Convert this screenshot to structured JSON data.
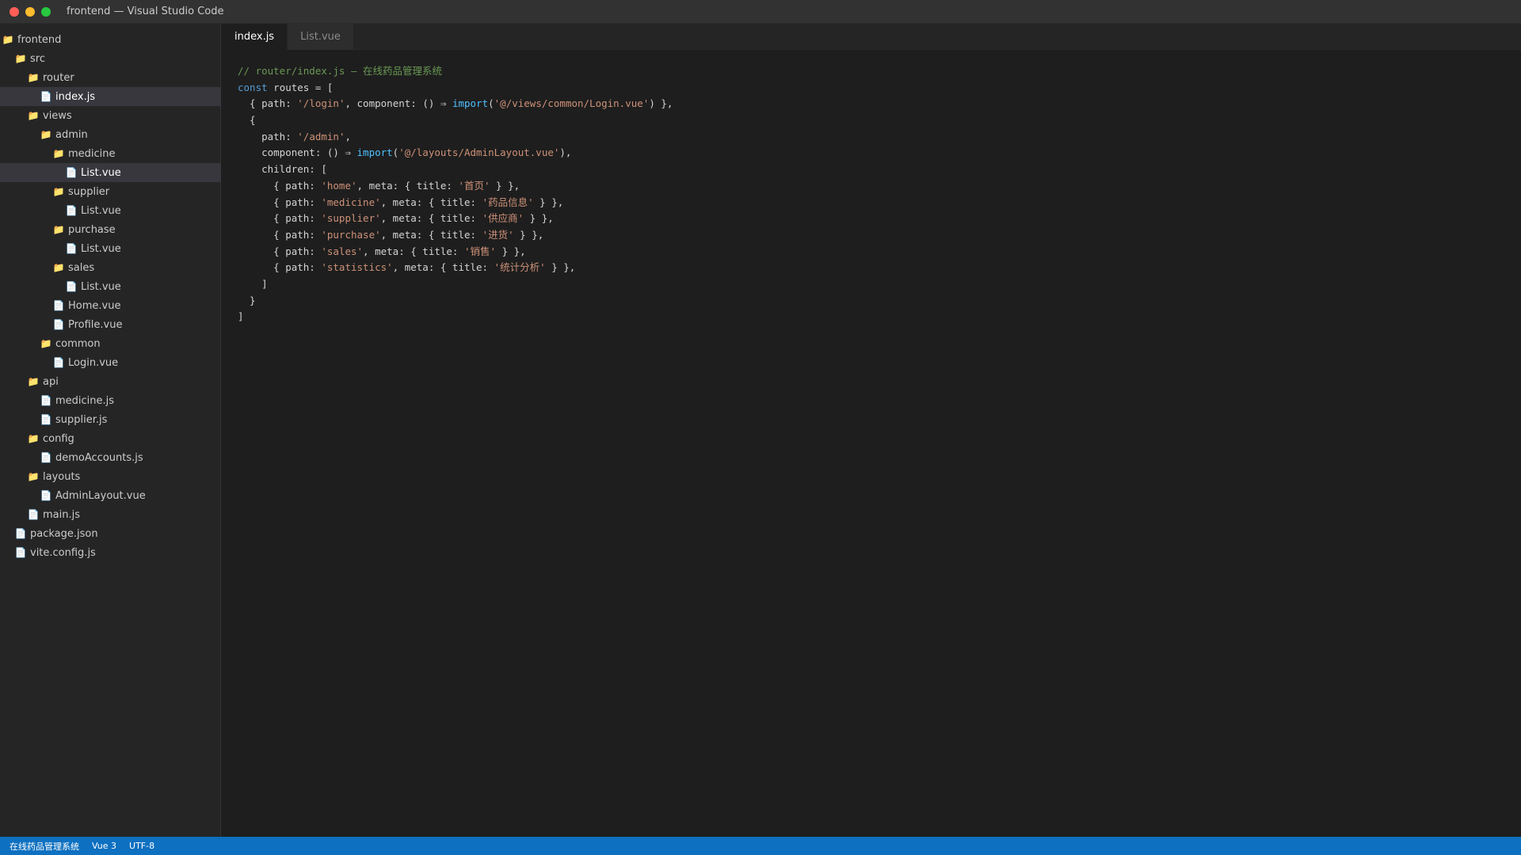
{
  "window": {
    "title": "frontend — Visual Studio Code"
  },
  "explorer": {
    "items": [
      {
        "label": "frontend",
        "type": "folder",
        "depth": 0
      },
      {
        "label": "src",
        "type": "folder",
        "depth": 1
      },
      {
        "label": "router",
        "type": "folder",
        "depth": 2
      },
      {
        "label": "index.js",
        "type": "file",
        "depth": 3,
        "active": true
      },
      {
        "label": "views",
        "type": "folder",
        "depth": 2
      },
      {
        "label": "admin",
        "type": "folder",
        "depth": 3
      },
      {
        "label": "medicine",
        "type": "folder",
        "depth": 4
      },
      {
        "label": "List.vue",
        "type": "file",
        "depth": 5,
        "active": true
      },
      {
        "label": "supplier",
        "type": "folder",
        "depth": 4
      },
      {
        "label": "List.vue",
        "type": "file",
        "depth": 5
      },
      {
        "label": "purchase",
        "type": "folder",
        "depth": 4
      },
      {
        "label": "List.vue",
        "type": "file",
        "depth": 5
      },
      {
        "label": "sales",
        "type": "folder",
        "depth": 4
      },
      {
        "label": "List.vue",
        "type": "file",
        "depth": 5
      },
      {
        "label": "Home.vue",
        "type": "file",
        "depth": 4
      },
      {
        "label": "Profile.vue",
        "type": "file",
        "depth": 4
      },
      {
        "label": "common",
        "type": "folder",
        "depth": 3
      },
      {
        "label": "Login.vue",
        "type": "file",
        "depth": 4
      },
      {
        "label": "api",
        "type": "folder",
        "depth": 2
      },
      {
        "label": "medicine.js",
        "type": "file",
        "depth": 3
      },
      {
        "label": "supplier.js",
        "type": "file",
        "depth": 3
      },
      {
        "label": "config",
        "type": "folder",
        "depth": 2
      },
      {
        "label": "demoAccounts.js",
        "type": "file",
        "depth": 3
      },
      {
        "label": "layouts",
        "type": "folder",
        "depth": 2
      },
      {
        "label": "AdminLayout.vue",
        "type": "file",
        "depth": 3
      },
      {
        "label": "main.js",
        "type": "file",
        "depth": 2
      },
      {
        "label": "package.json",
        "type": "file",
        "depth": 1
      },
      {
        "label": "vite.config.js",
        "type": "file",
        "depth": 1
      }
    ]
  },
  "tabs": [
    {
      "label": "index.js",
      "active": true
    },
    {
      "label": "List.vue",
      "active": false
    }
  ],
  "editor": {
    "lines": [
      [
        {
          "t": "// router/index.js — 在线药品管理系统",
          "c": "cm"
        }
      ],
      [
        {
          "t": "const",
          "c": "kw"
        },
        {
          "t": " routes = ["
        }
      ],
      [
        {
          "t": "  { path: "
        },
        {
          "t": "'/login'",
          "c": "str"
        },
        {
          "t": ", component: () ⇒ "
        },
        {
          "t": "import",
          "c": "fn"
        },
        {
          "t": "("
        },
        {
          "t": "'@/views/common/Login.vue'",
          "c": "str"
        },
        {
          "t": ") },"
        }
      ],
      [
        {
          "t": "  {"
        }
      ],
      [
        {
          "t": "    path: "
        },
        {
          "t": "'/admin'",
          "c": "str"
        },
        {
          "t": ","
        }
      ],
      [
        {
          "t": "    component: () ⇒ "
        },
        {
          "t": "import",
          "c": "fn"
        },
        {
          "t": "("
        },
        {
          "t": "'@/layouts/AdminLayout.vue'",
          "c": "str"
        },
        {
          "t": "),"
        }
      ],
      [
        {
          "t": "    children: ["
        }
      ],
      [
        {
          "t": "      { path: "
        },
        {
          "t": "'home'",
          "c": "str"
        },
        {
          "t": ", meta: { title: "
        },
        {
          "t": "'首页'",
          "c": "str"
        },
        {
          "t": " } },"
        }
      ],
      [
        {
          "t": "      { path: "
        },
        {
          "t": "'medicine'",
          "c": "str"
        },
        {
          "t": ", meta: { title: "
        },
        {
          "t": "'药品信息'",
          "c": "str"
        },
        {
          "t": " } },"
        }
      ],
      [
        {
          "t": "      { path: "
        },
        {
          "t": "'supplier'",
          "c": "str"
        },
        {
          "t": ", meta: { title: "
        },
        {
          "t": "'供应商'",
          "c": "str"
        },
        {
          "t": " } },"
        }
      ],
      [
        {
          "t": "      { path: "
        },
        {
          "t": "'purchase'",
          "c": "str"
        },
        {
          "t": ", meta: { title: "
        },
        {
          "t": "'进货'",
          "c": "str"
        },
        {
          "t": " } },"
        }
      ],
      [
        {
          "t": "      { path: "
        },
        {
          "t": "'sales'",
          "c": "str"
        },
        {
          "t": ", meta: { title: "
        },
        {
          "t": "'销售'",
          "c": "str"
        },
        {
          "t": " } },"
        }
      ],
      [
        {
          "t": "      { path: "
        },
        {
          "t": "'statistics'",
          "c": "str"
        },
        {
          "t": ", meta: { title: "
        },
        {
          "t": "'统计分析'",
          "c": "str"
        },
        {
          "t": " } },"
        }
      ],
      [
        {
          "t": "    ]"
        }
      ],
      [
        {
          "t": "  }"
        }
      ],
      [
        {
          "t": "]"
        }
      ]
    ]
  },
  "statusbar": {
    "project": "在线药品管理系统",
    "framework": "Vue 3",
    "encoding": "UTF-8"
  },
  "colors": {
    "statusbar": "#0e70c0",
    "comment": "#6a9955",
    "keyword": "#569cd6",
    "string": "#ce9178",
    "folder_icon": "#dcb67a"
  }
}
